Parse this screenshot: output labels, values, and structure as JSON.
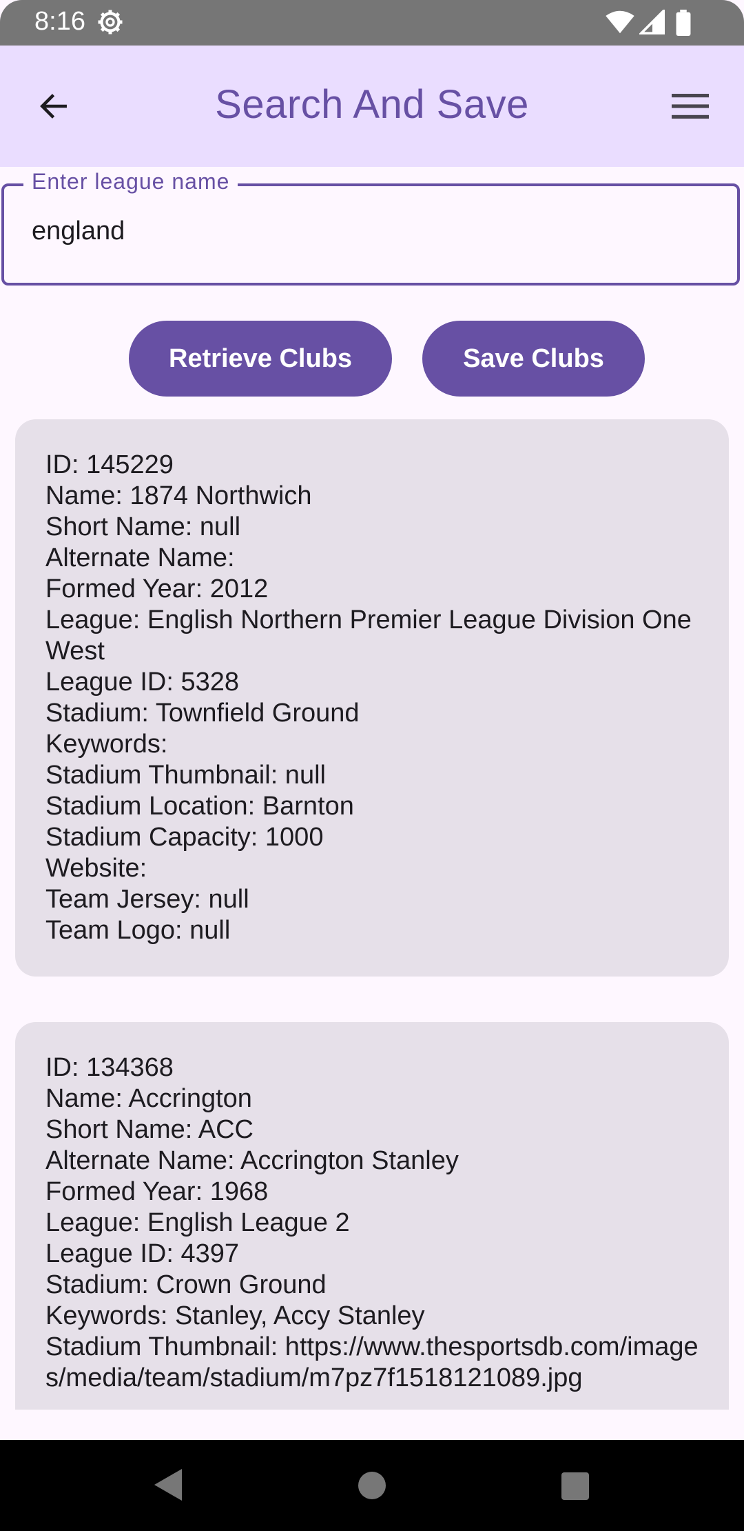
{
  "status_bar": {
    "time": "8:16",
    "icons": [
      "settings-gear-icon",
      "wifi-icon",
      "cell-signal-icon",
      "battery-icon"
    ]
  },
  "app_bar": {
    "title": "Search And Save",
    "back_icon": "arrow-back-icon",
    "menu_icon": "hamburger-menu-icon"
  },
  "search": {
    "label": "Enter league name",
    "value": "england"
  },
  "actions": {
    "retrieve_label": "Retrieve Clubs",
    "save_label": "Save Clubs"
  },
  "clubs": [
    {
      "lines": [
        "ID: 145229",
        "Name: 1874 Northwich",
        "Short Name: null",
        "Alternate Name:",
        "Formed Year: 2012",
        "League: English Northern Premier League Division One West",
        "League ID: 5328",
        "Stadium: Townfield Ground",
        "Keywords:",
        "Stadium Thumbnail: null",
        "Stadium Location: Barnton",
        "Stadium Capacity: 1000",
        "Website:",
        "Team Jersey: null",
        "Team Logo: null"
      ]
    },
    {
      "lines": [
        "ID: 134368",
        "Name: Accrington",
        "Short Name: ACC",
        "Alternate Name: Accrington Stanley",
        "Formed Year: 1968",
        "League: English League 2",
        "League ID: 4397",
        "Stadium: Crown Ground",
        "Keywords: Stanley, Accy Stanley",
        "Stadium Thumbnail: https://www.thesportsdb.com/images/media/team/stadium/m7pz7f1518121089.jpg"
      ]
    }
  ],
  "colors": {
    "primary": "#6750a4",
    "app_bar_bg": "#eaddff",
    "card_bg": "#e6e0e9",
    "page_bg": "#fef7ff"
  }
}
